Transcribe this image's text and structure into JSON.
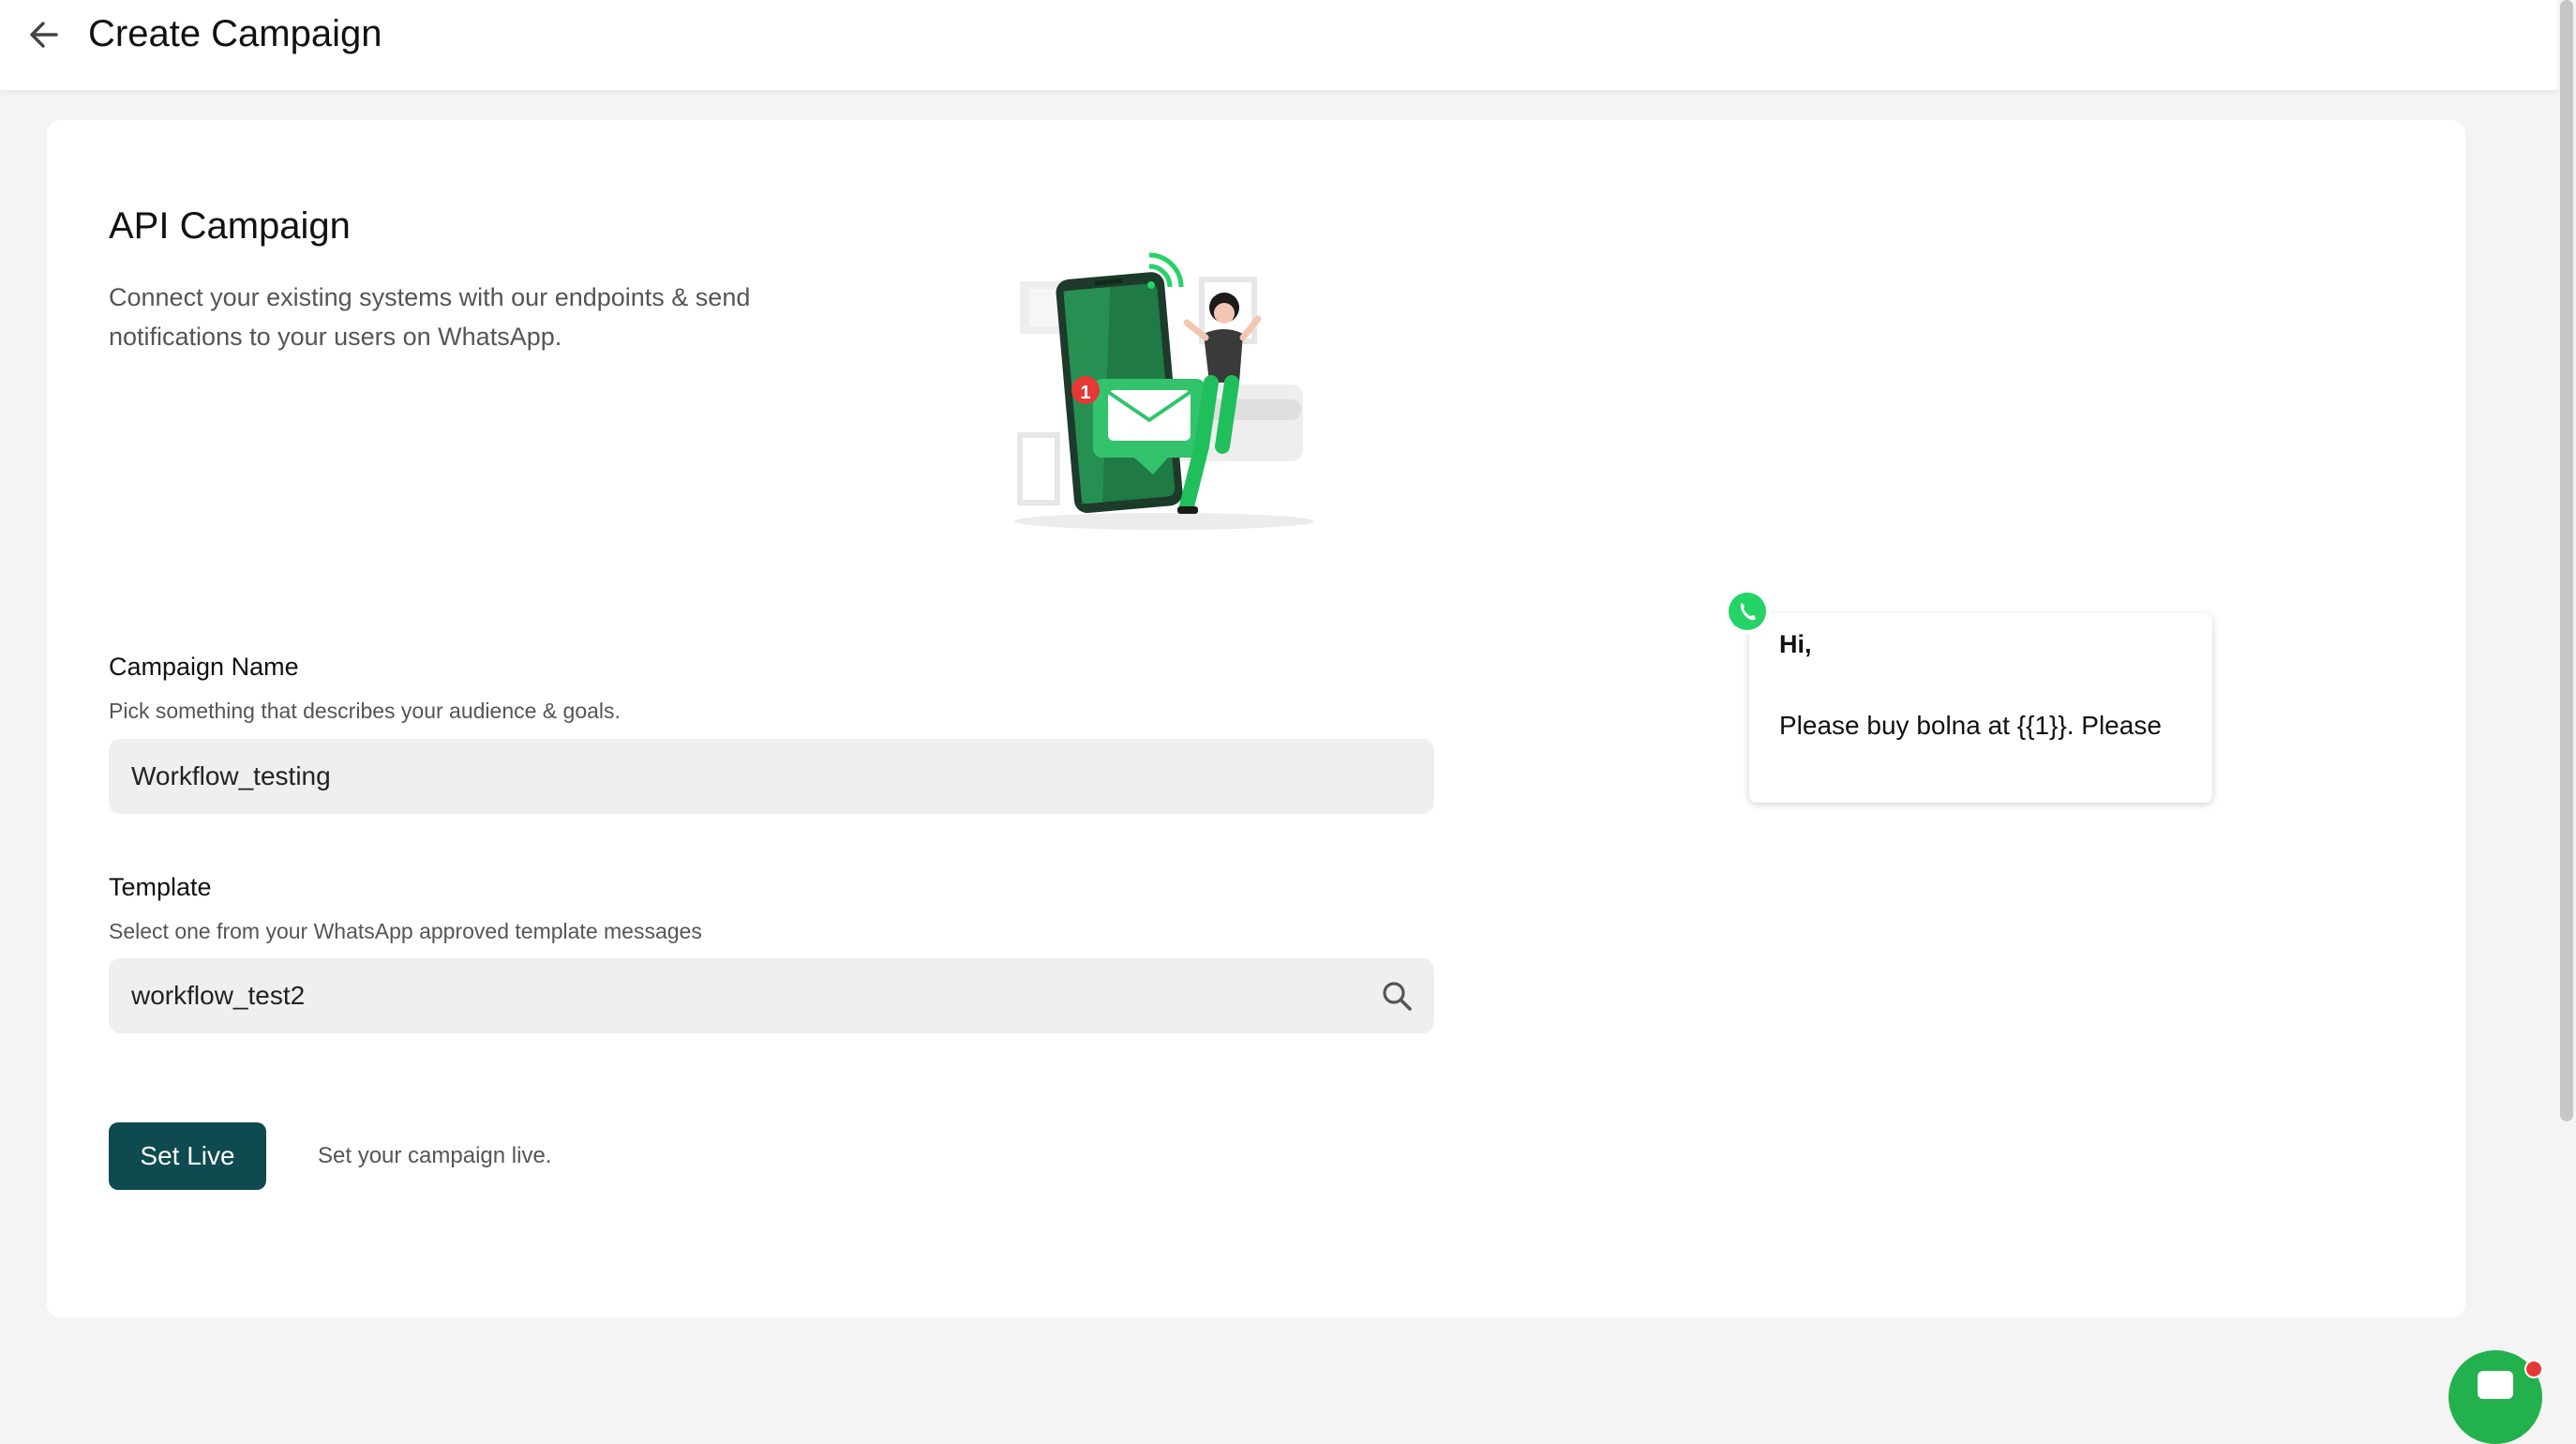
{
  "header": {
    "back_icon": "arrow-left-icon",
    "title": "Create Campaign"
  },
  "intro": {
    "title": "API Campaign",
    "description": "Connect your existing systems with our endpoints & send notifications to your users on WhatsApp.",
    "illustration_icon": "phone-notification-illustration",
    "notification_count": "1"
  },
  "campaign_name": {
    "label": "Campaign Name",
    "help": "Pick something that describes your audience & goals.",
    "value": "Workflow_testing"
  },
  "template": {
    "label": "Template",
    "help": "Select one from your WhatsApp approved template messages",
    "value": "workflow_test2",
    "icon": "search-icon"
  },
  "actions": {
    "set_live_label": "Set Live",
    "set_live_desc": "Set your campaign live."
  },
  "preview": {
    "icon": "whatsapp-icon",
    "greeting": "Hi,",
    "body": "Please buy bolna at {{1}}. Please"
  },
  "colors": {
    "primary": "#0e4a4f",
    "whatsapp": "#25d366",
    "chat_widget": "#22b14c",
    "notification": "#e53935"
  }
}
